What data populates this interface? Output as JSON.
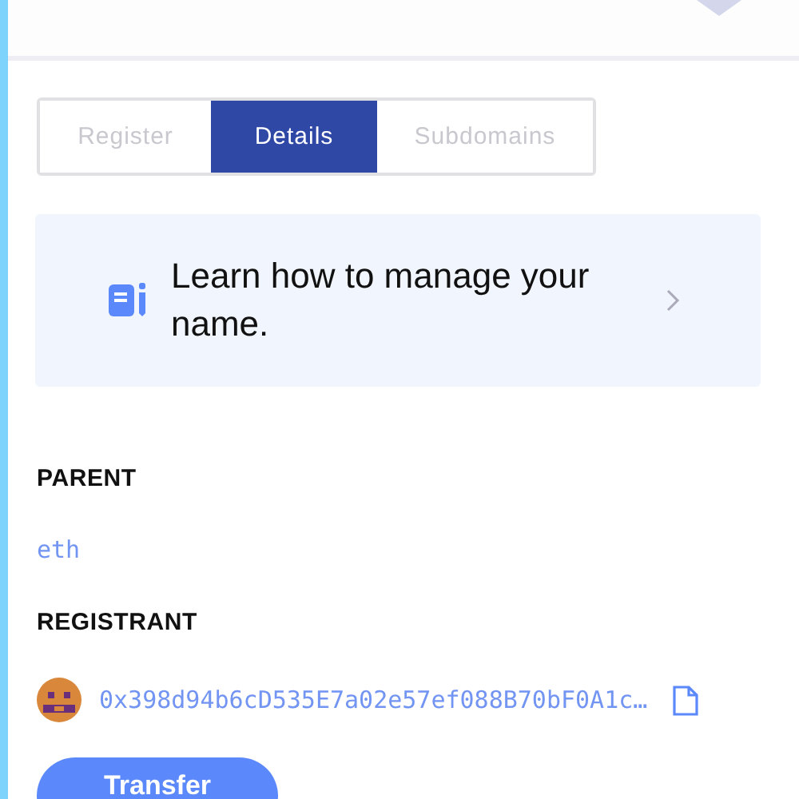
{
  "tabs": [
    {
      "label": "Register",
      "selected": false
    },
    {
      "label": "Details",
      "selected": true
    },
    {
      "label": "Subdomains",
      "selected": false
    }
  ],
  "info_card": {
    "text": "Learn how to manage your name."
  },
  "details": [
    {
      "label": "PARENT",
      "kind": "link",
      "value": "eth"
    },
    {
      "label": "REGISTRANT",
      "kind": "address",
      "value": "0x398d94b6cD535E7a02e57ef088B70bF0A1c…"
    }
  ],
  "buttons": [
    {
      "label": "Transfer"
    }
  ]
}
